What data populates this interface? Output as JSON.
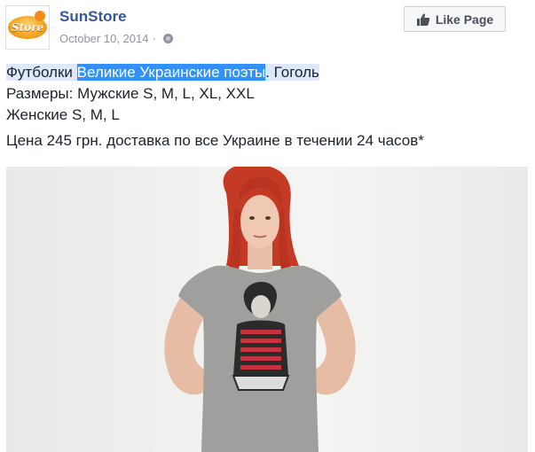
{
  "page": {
    "name": "SunStore",
    "logo_text": "Store",
    "date": "October 10, 2014",
    "meta_separator": "·",
    "like_button_label": "Like Page",
    "privacy_icon": "globe-icon",
    "like_icon": "thumbs-up-icon"
  },
  "post": {
    "line1_part1": "Футболки ",
    "line1_highlight": "Великие Украинские поэты",
    "line1_part2": ". Гоголь",
    "line2": "Размеры: Мужские S, M, L, XL, XXL",
    "line3": "Женские S, M, L",
    "line4": "Цена 245 грн. доставка по все Украине в течении 24 часов*"
  },
  "colors": {
    "page_name": "#365899",
    "meta": "#90949c",
    "selection": "#3390ff",
    "selection_light": "#dde8fb"
  }
}
